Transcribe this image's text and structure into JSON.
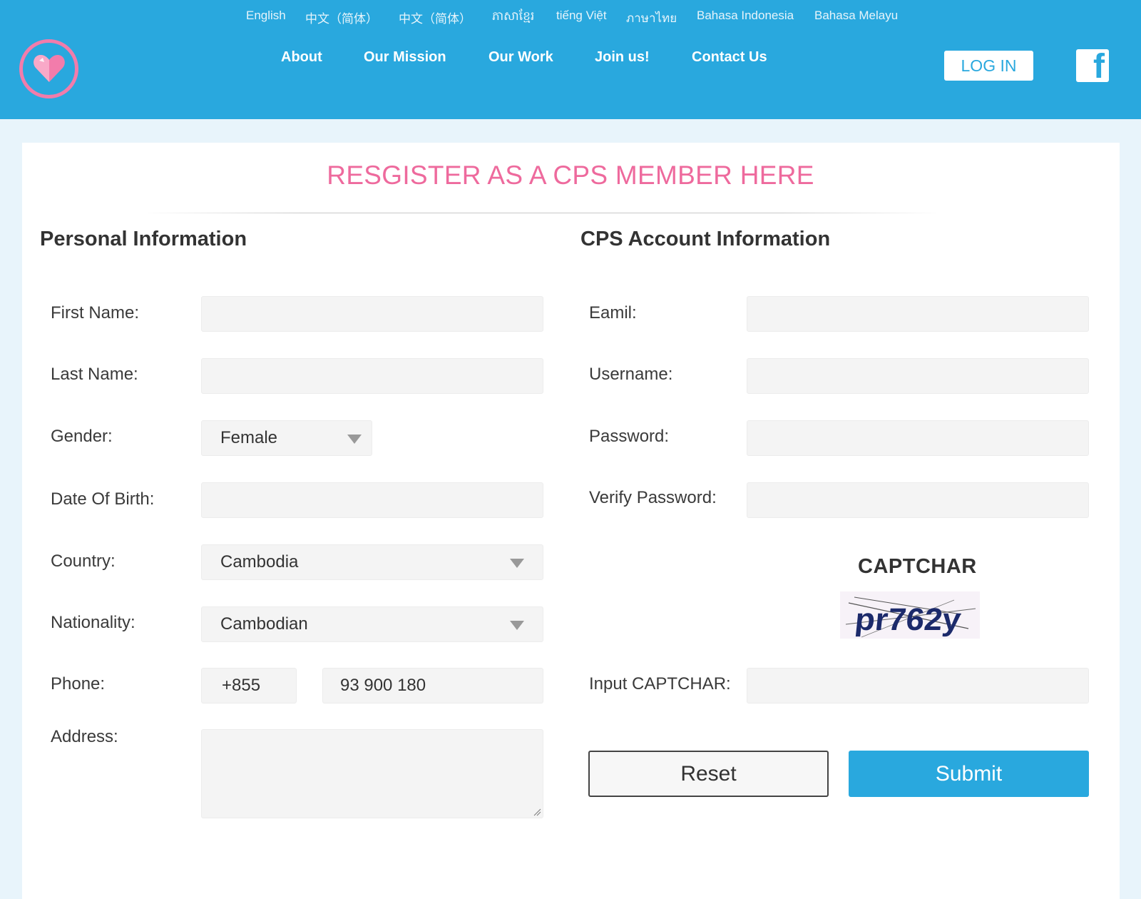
{
  "languages": [
    "English",
    "中文（简体）",
    "中文（简体）",
    "ភាសាខ្មែរ",
    "tiếng Việt",
    "ภาษาไทย",
    "Bahasa Indonesia",
    "Bahasa Melayu"
  ],
  "nav": {
    "items": [
      "About",
      "Our Mission",
      "Our Work",
      "Join us!",
      "Contact Us"
    ],
    "login_label": "LOG IN",
    "facebook_glyph": "f",
    "logo_icon": "heart-icon"
  },
  "page": {
    "title": "RESGISTER AS A CPS MEMBER HERE"
  },
  "personal": {
    "title": "Personal Information",
    "first_name_label": "First Name:",
    "first_name_value": "",
    "last_name_label": "Last Name:",
    "last_name_value": "",
    "gender_label": "Gender:",
    "gender_value": "Female",
    "dob_label": "Date Of Birth:",
    "dob_value": "",
    "country_label": "Country:",
    "country_value": "Cambodia",
    "nationality_label": "Nationality:",
    "nationality_value": "Cambodian",
    "phone_label": "Phone:",
    "phone_code": "+855",
    "phone_number": "93 900 180",
    "address_label": "Address:",
    "address_value": ""
  },
  "account": {
    "title": "CPS Account Information",
    "email_label": "Eamil:",
    "email_value": "",
    "username_label": "Username:",
    "username_value": "",
    "password_label": "Password:",
    "password_value": "",
    "verify_label": "Verify Password:",
    "verify_value": "",
    "captcha_title": "CAPTCHAR",
    "captcha_text": "pr762y",
    "captcha_input_label": "Input CAPTCHAR:",
    "captcha_input_value": ""
  },
  "buttons": {
    "reset": "Reset",
    "submit": "Submit"
  },
  "colors": {
    "header_bg": "#29a8de",
    "title_pink": "#ee6a9d",
    "page_bg": "#e8f4fb",
    "field_bg": "#f4f4f4"
  }
}
